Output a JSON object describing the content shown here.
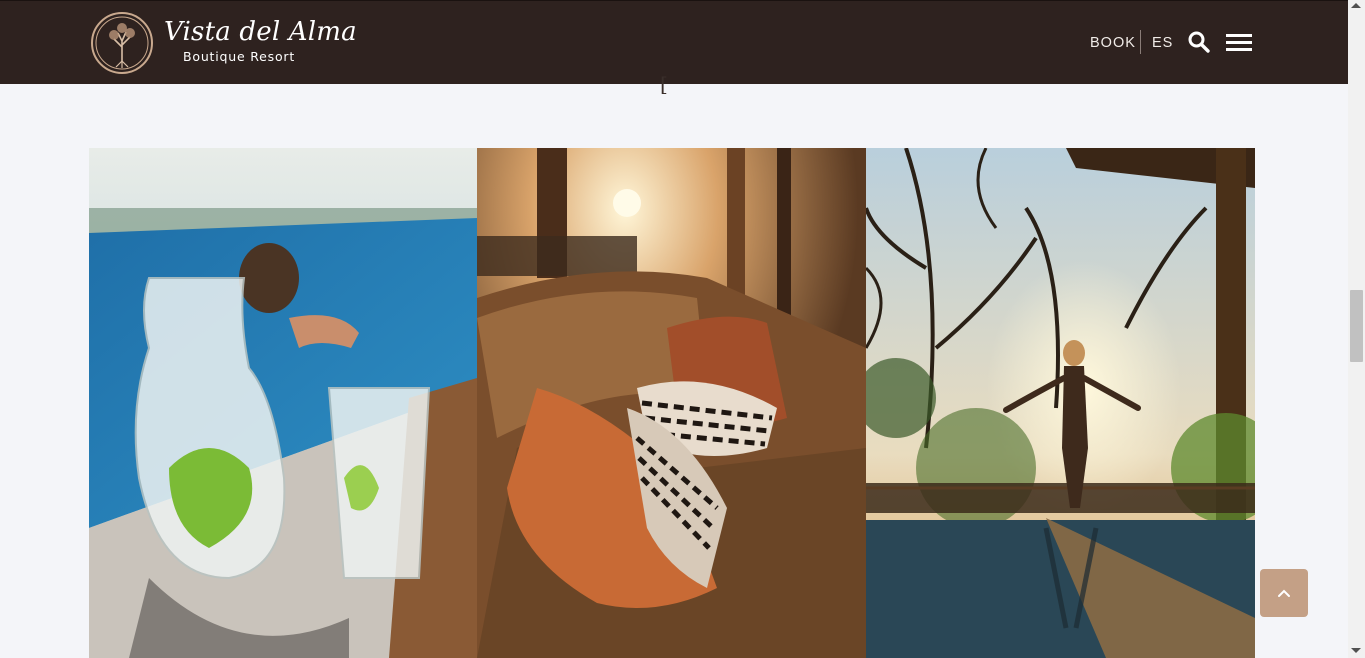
{
  "header": {
    "brand_name": "Vista del Alma",
    "brand_tagline": "Boutique Resort",
    "nav_book": "BOOK",
    "nav_language": "ES",
    "search_icon": "search-icon",
    "menu_icon": "hamburger-menu-icon"
  },
  "gallery": {
    "photos": [
      {
        "subject": "mint-water-carafe-by-pool"
      },
      {
        "subject": "sofa-with-cushions-sunlight"
      },
      {
        "subject": "woman-on-deck-at-sunset"
      }
    ]
  },
  "controls": {
    "back_to_top_icon": "chevron-up-icon"
  },
  "colors": {
    "header_bg": "#2e221f",
    "page_bg": "#f4f5f9",
    "accent": "#c4a086"
  }
}
